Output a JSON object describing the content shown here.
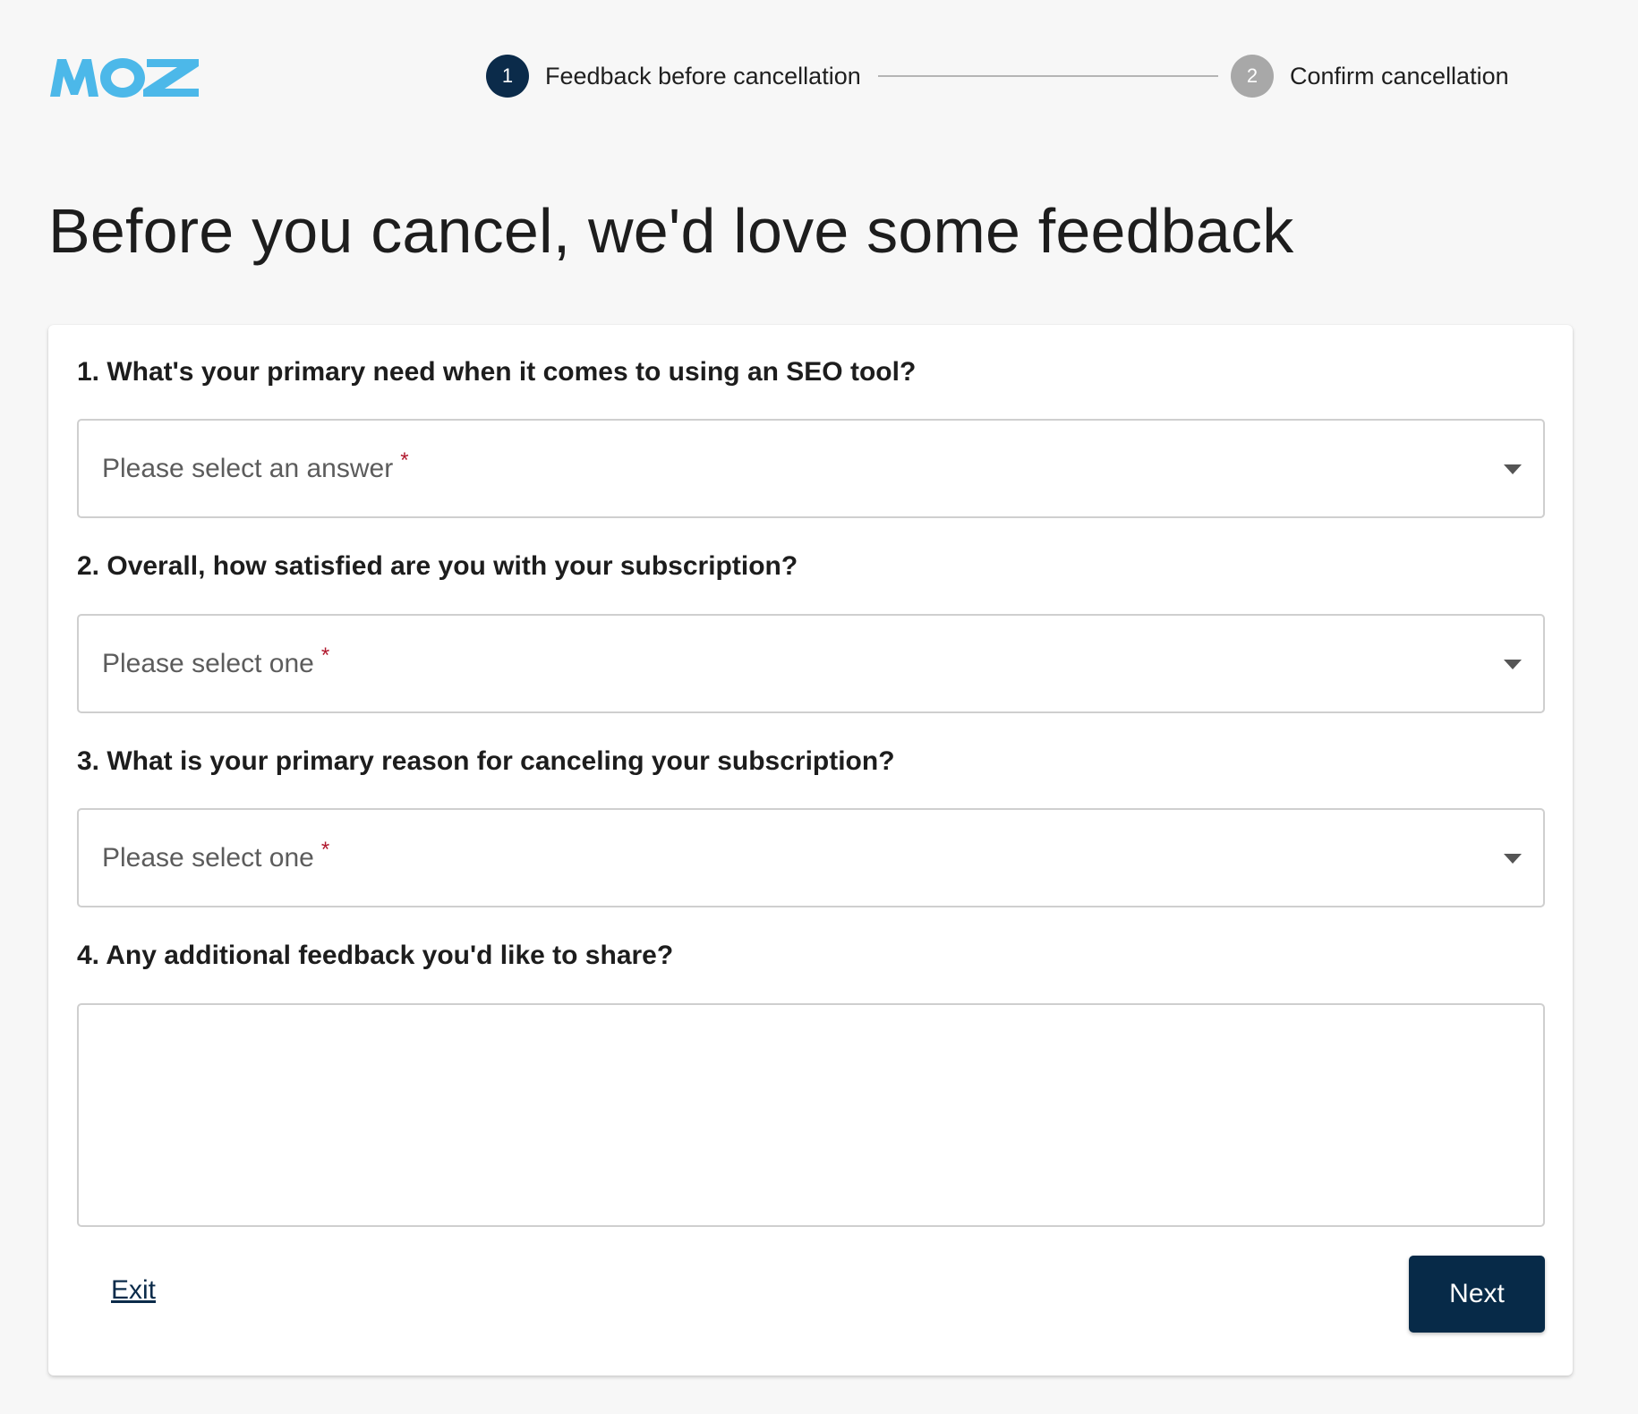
{
  "brand": {
    "logo_text": "MOZ",
    "logo_color": "#4cb8e9"
  },
  "stepper": {
    "steps": [
      {
        "number": "1",
        "label": "Feedback before cancellation",
        "state": "active"
      },
      {
        "number": "2",
        "label": "Confirm cancellation",
        "state": "inactive"
      }
    ],
    "active_color": "#0b2b4a",
    "inactive_color": "#a8a8a8"
  },
  "page": {
    "title": "Before you cancel, we'd love some feedback"
  },
  "form": {
    "questions": [
      {
        "label": "1. What's your primary need when it comes to using an SEO tool?",
        "type": "select",
        "placeholder": "Please select an answer",
        "required_mark": "*"
      },
      {
        "label": "2. Overall, how satisfied are you with your subscription?",
        "type": "select",
        "placeholder": "Please select one",
        "required_mark": "*"
      },
      {
        "label": "3. What is your primary reason for canceling your subscription?",
        "type": "select",
        "placeholder": "Please select one",
        "required_mark": "*"
      },
      {
        "label": "4. Any additional feedback you'd like to share?",
        "type": "textarea",
        "value": ""
      }
    ],
    "required_color": "#b0182d"
  },
  "actions": {
    "exit_label": "Exit",
    "next_label": "Next",
    "primary_color": "#072a48"
  }
}
